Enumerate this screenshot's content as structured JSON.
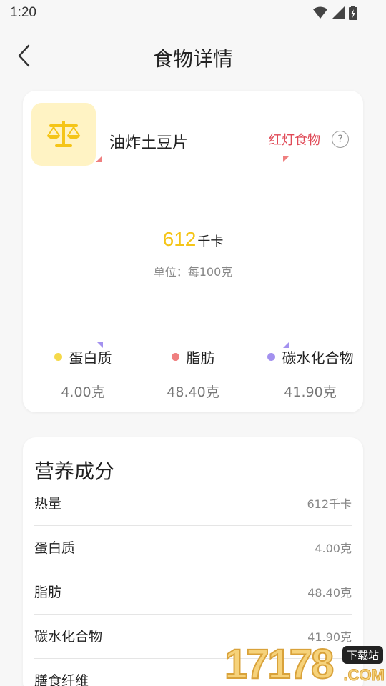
{
  "status_bar": {
    "time": "1:20"
  },
  "header": {
    "title": "食物详情"
  },
  "food": {
    "name": "油炸土豆片",
    "light_label": "红灯食物",
    "help_symbol": "?",
    "kcal_value": "612",
    "kcal_unit": "千卡",
    "unit_line": "单位：每100克",
    "icon": "scale-icon",
    "colors": {
      "accent_yellow": "#f5c518",
      "red_label": "#e04a57"
    }
  },
  "macros": [
    {
      "name": "蛋白质",
      "value": "4.00克",
      "color": "#f5d94a"
    },
    {
      "name": "脂肪",
      "value": "48.40克",
      "color": "#ef7f7f"
    },
    {
      "name": "碳水化合物",
      "value": "41.90克",
      "color": "#a391ef"
    }
  ],
  "nutrition": {
    "title": "营养成分",
    "rows": [
      {
        "name": "热量",
        "value": "612千卡"
      },
      {
        "name": "蛋白质",
        "value": "4.00克"
      },
      {
        "name": "脂肪",
        "value": "48.40克"
      },
      {
        "name": "碳水化合物",
        "value": "41.90克"
      },
      {
        "name": "膳食纤维",
        "value": ""
      }
    ]
  },
  "watermark": {
    "number": "17178",
    "tag": "下载站",
    "suffix": ".COM"
  }
}
